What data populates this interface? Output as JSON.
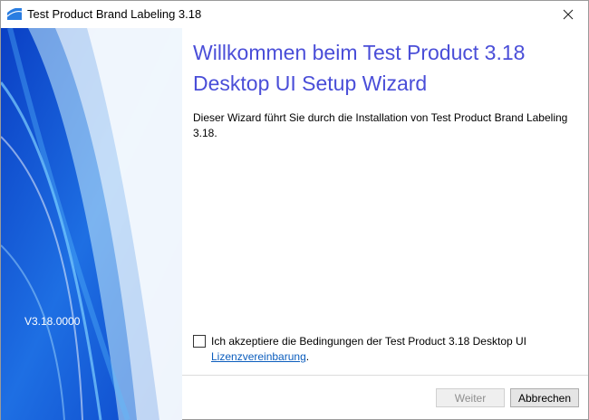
{
  "window": {
    "title": "Test Product Brand Labeling 3.18"
  },
  "side_panel": {
    "version": "V3.18.0000"
  },
  "main": {
    "heading": "Willkommen beim Test Product 3.18 Desktop UI Setup Wizard",
    "intro": "Dieser Wizard führt Sie durch die Installation von Test Product Brand Labeling 3.18."
  },
  "license": {
    "checkbox_label": "Ich akzeptiere die Bedingungen der Test Product 3.18 Desktop UI",
    "link_text": "Lizenzvereinbarung",
    "link_suffix": ".",
    "checked": false
  },
  "buttons": {
    "next_label": "Weiter",
    "next_enabled": false,
    "cancel_label": "Abbrechen"
  },
  "icons": {
    "app": "installer-icon",
    "close": "close-icon"
  },
  "colors": {
    "heading": "#4a4ed8",
    "link": "#0b5dbd",
    "panel_blue": "#1d5fd8"
  }
}
